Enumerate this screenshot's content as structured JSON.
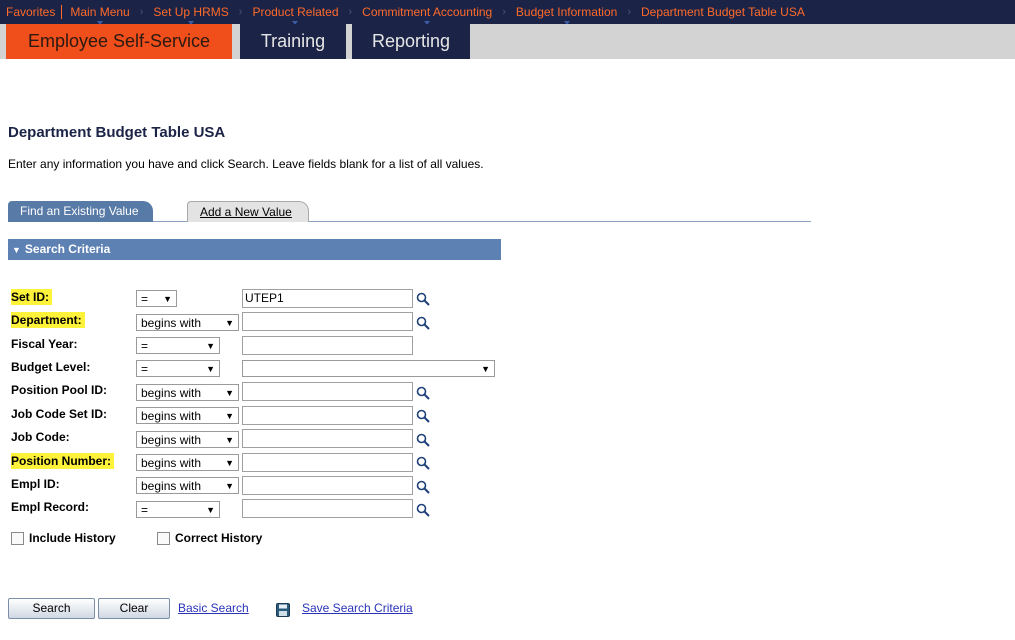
{
  "breadcrumb": {
    "favorites": "Favorites",
    "main_menu": "Main Menu",
    "items": [
      "Set Up HRMS",
      "Product Related",
      "Commitment Accounting",
      "Budget Information",
      "Department Budget Table USA"
    ]
  },
  "top_tabs": [
    "Employee Self-Service",
    "Training",
    "Reporting"
  ],
  "page": {
    "title": "Department Budget Table USA",
    "instructions": "Enter any information you have and click Search. Leave fields blank for a list of all values."
  },
  "tabs": {
    "find": "Find an Existing Value",
    "add": "Add a New Value"
  },
  "search_criteria": {
    "header": "Search Criteria",
    "fields": [
      {
        "label": "Set ID:",
        "operator": "=",
        "value": "UTEP1",
        "highlight": true,
        "lookup": true
      },
      {
        "label": "Department:",
        "operator": "begins with",
        "value": "",
        "highlight": true,
        "lookup": true
      },
      {
        "label": "Fiscal Year:",
        "operator": "=",
        "value": "",
        "highlight": false,
        "lookup": false
      },
      {
        "label": "Budget Level:",
        "operator": "=",
        "value": "",
        "highlight": false,
        "lookup": false
      },
      {
        "label": "Position Pool ID:",
        "operator": "begins with",
        "value": "",
        "highlight": false,
        "lookup": true
      },
      {
        "label": "Job Code Set ID:",
        "operator": "begins with",
        "value": "",
        "highlight": false,
        "lookup": true
      },
      {
        "label": "Job Code:",
        "operator": "begins with",
        "value": "",
        "highlight": false,
        "lookup": true
      },
      {
        "label": "Position Number:",
        "operator": "begins with",
        "value": "",
        "highlight": true,
        "lookup": true
      },
      {
        "label": "Empl ID:",
        "operator": "begins with",
        "value": "",
        "highlight": false,
        "lookup": true
      },
      {
        "label": "Empl Record:",
        "operator": "=",
        "value": "",
        "highlight": false,
        "lookup": true
      }
    ],
    "include_history": "Include History",
    "correct_history": "Correct History"
  },
  "actions": {
    "search": "Search",
    "clear": "Clear",
    "basic_search": "Basic Search",
    "save_search": "Save Search Criteria"
  },
  "colors": {
    "nav_bg": "#1b2346",
    "accent_orange": "#f04e1a",
    "highlight": "#fff23b",
    "section_blue": "#5e81b3",
    "link": "#2a33b8"
  }
}
